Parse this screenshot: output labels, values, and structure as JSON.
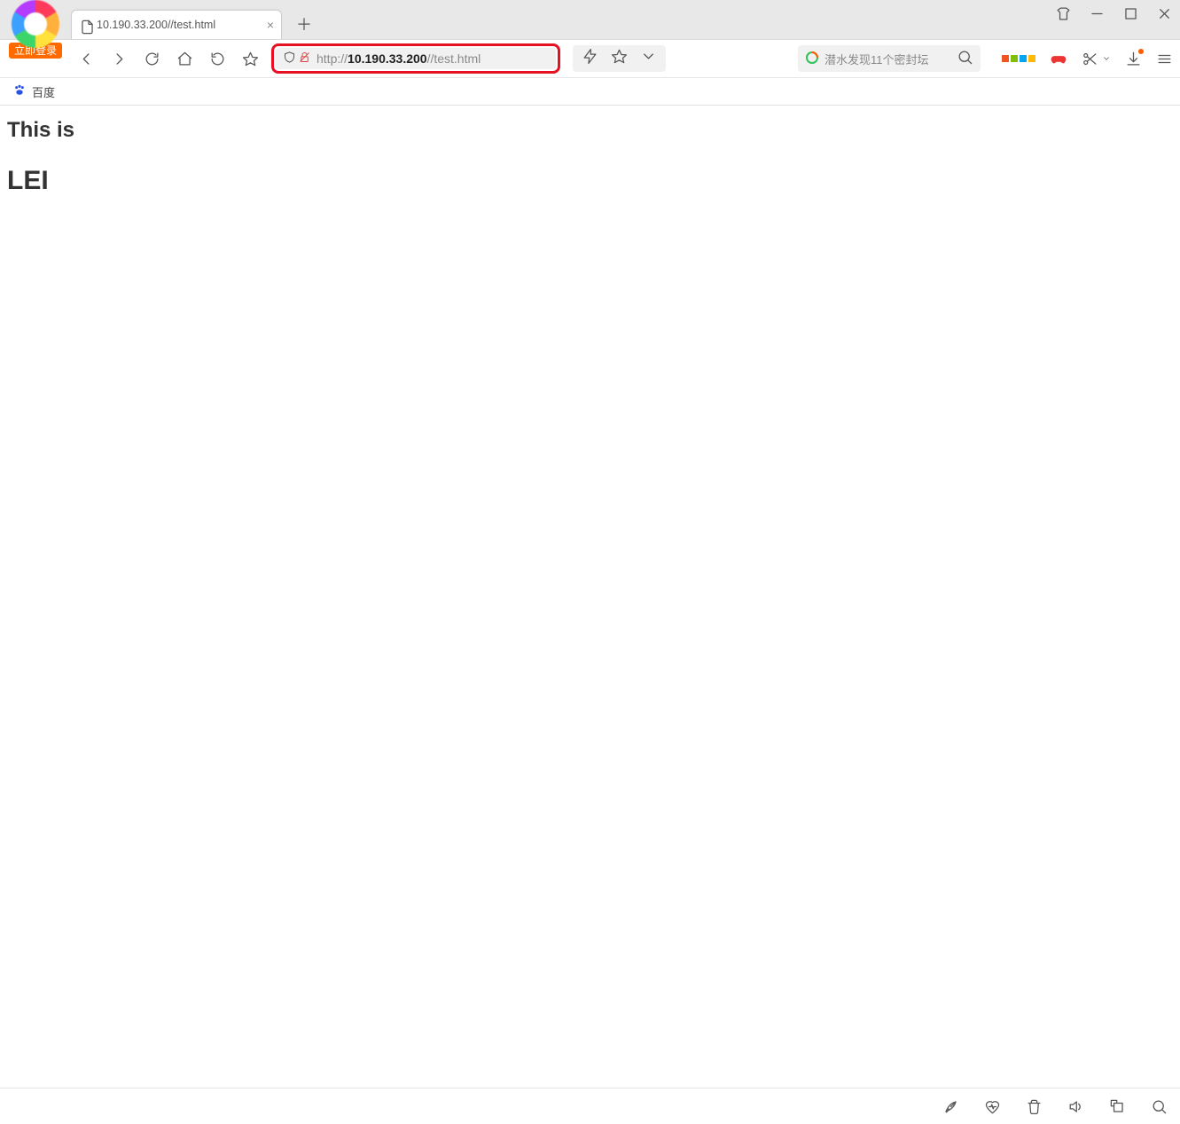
{
  "loginBadge": "立即登录",
  "tab": {
    "title": "10.190.33.200//test.html"
  },
  "url": {
    "prefix": "http://",
    "host": "10.190.33.200",
    "path": "//test.html"
  },
  "search": {
    "placeholder": "潜水发现11个密封坛"
  },
  "bookmark": {
    "baidu": "百度"
  },
  "page": {
    "line1": "This is",
    "line2": "LEI"
  }
}
